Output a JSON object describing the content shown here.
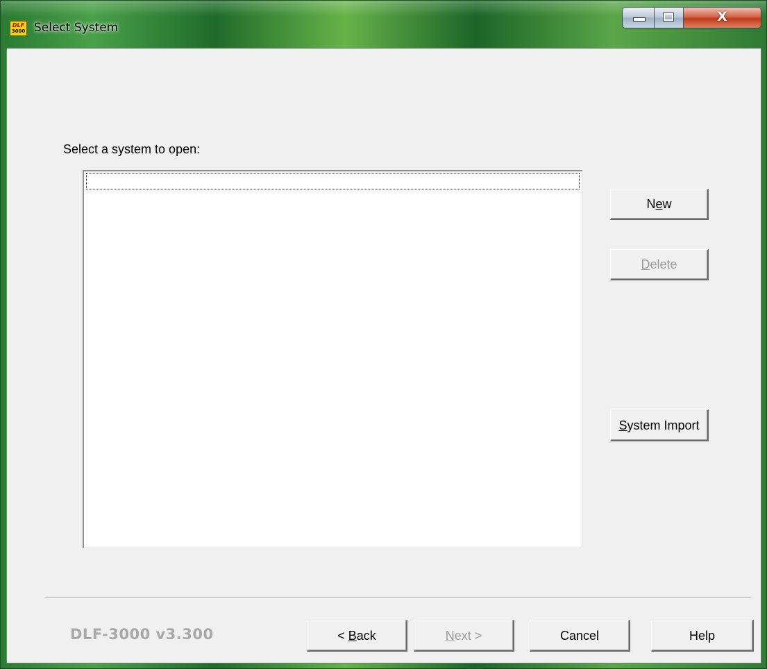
{
  "window": {
    "title": "Select System",
    "app_icon": {
      "top": "DLF",
      "bottom": "3000"
    },
    "controls": {
      "minimize_icon": "minimize-icon",
      "maximize_icon": "maximize-icon",
      "close_glyph": "X"
    },
    "colors": {
      "title_accent": "#2a7a32",
      "client_bg": "#f0f0f0",
      "close_button": "#c0391c"
    }
  },
  "main": {
    "prompt": "Select a system to open:",
    "systems_list": [],
    "buttons": {
      "new": {
        "pre": "N",
        "ul": "e",
        "post": "w",
        "enabled": true
      },
      "delete": {
        "pre": "",
        "ul": "D",
        "post": "elete",
        "enabled": false
      },
      "system_import": {
        "pre": "",
        "ul": "S",
        "post": "ystem Import",
        "enabled": true
      }
    }
  },
  "footer": {
    "version": "DLF-3000 v3.300",
    "back": {
      "pre": "< ",
      "ul": "B",
      "post": "ack",
      "enabled": true
    },
    "next": {
      "pre": "",
      "ul": "N",
      "post": "ext >",
      "enabled": false
    },
    "cancel": {
      "label": "Cancel",
      "enabled": true
    },
    "help": {
      "label": "Help",
      "enabled": true
    }
  }
}
